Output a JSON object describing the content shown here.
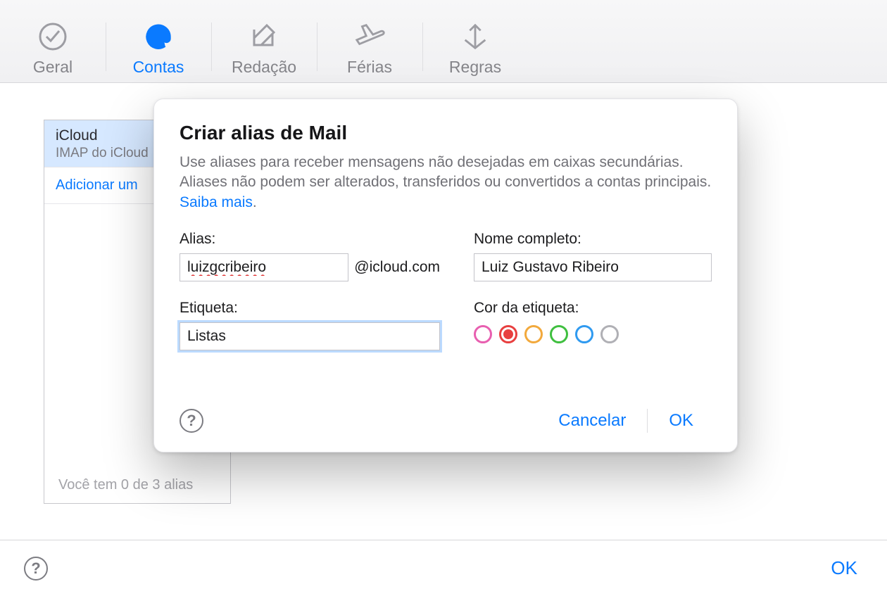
{
  "toolbar": {
    "items": [
      {
        "label": "Geral"
      },
      {
        "label": "Contas"
      },
      {
        "label": "Redação"
      },
      {
        "label": "Férias"
      },
      {
        "label": "Regras"
      }
    ],
    "active_index": 1
  },
  "sidebar": {
    "account": {
      "title": "iCloud",
      "subtitle": "IMAP do iCloud"
    },
    "add_label": "Adicionar um",
    "footer": "Você tem 0 de 3 alias"
  },
  "modal": {
    "title": "Criar alias de Mail",
    "description": "Use aliases para receber mensagens não desejadas em caixas secundárias. Aliases não podem ser alterados, transferidos ou convertidos a contas principais. ",
    "learn_more": "Saiba mais",
    "fields": {
      "alias_label": "Alias:",
      "alias_value": "luizgcribeiro",
      "alias_domain": "@icloud.com",
      "fullname_label": "Nome completo:",
      "fullname_value": "Luiz Gustavo Ribeiro",
      "etiqueta_label": "Etiqueta:",
      "etiqueta_value": "Listas",
      "color_label": "Cor da etiqueta:"
    },
    "colors": [
      {
        "name": "pink",
        "hex": "#e85fb0",
        "selected": false
      },
      {
        "name": "red",
        "hex": "#e83f3f",
        "selected": true
      },
      {
        "name": "orange",
        "hex": "#f2a93c",
        "selected": false
      },
      {
        "name": "green",
        "hex": "#3fbf3f",
        "selected": false
      },
      {
        "name": "blue",
        "hex": "#2f9af0",
        "selected": false
      },
      {
        "name": "gray",
        "hex": "#b0b0b5",
        "selected": false
      }
    ],
    "buttons": {
      "cancel": "Cancelar",
      "ok": "OK"
    },
    "help_glyph": "?"
  },
  "page_footer": {
    "help_glyph": "?",
    "ok": "OK"
  }
}
